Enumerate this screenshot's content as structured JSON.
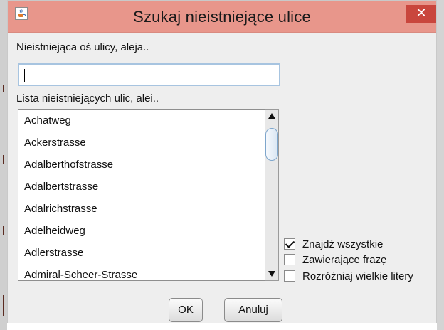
{
  "window": {
    "title": "Szukaj nieistniejące ulice",
    "close_glyph": "✕",
    "app_icon": "java-coffee-icon"
  },
  "search": {
    "label": "Nieistniejąca oś ulicy, aleja..",
    "value": ""
  },
  "list": {
    "label": "Lista nieistniejących ulic, alei..",
    "items": [
      "Achatweg",
      "Ackerstrasse",
      "Adalberthofstrasse",
      "Adalbertstrasse",
      "Adalrichstrasse",
      "Adelheidweg",
      "Adlerstrasse",
      "Admiral-Scheer-Strasse"
    ]
  },
  "options": [
    {
      "label": "Znajdź wszystkie",
      "checked": true
    },
    {
      "label": "Zawierające frazę",
      "checked": false
    },
    {
      "label": "Rozróżniaj wielkie litery",
      "checked": false
    }
  ],
  "buttons": {
    "ok": "OK",
    "cancel": "Anuluj"
  },
  "colors": {
    "titlebar": "#e8968b",
    "close": "#c9463d",
    "input_border": "#a7c4e0"
  }
}
